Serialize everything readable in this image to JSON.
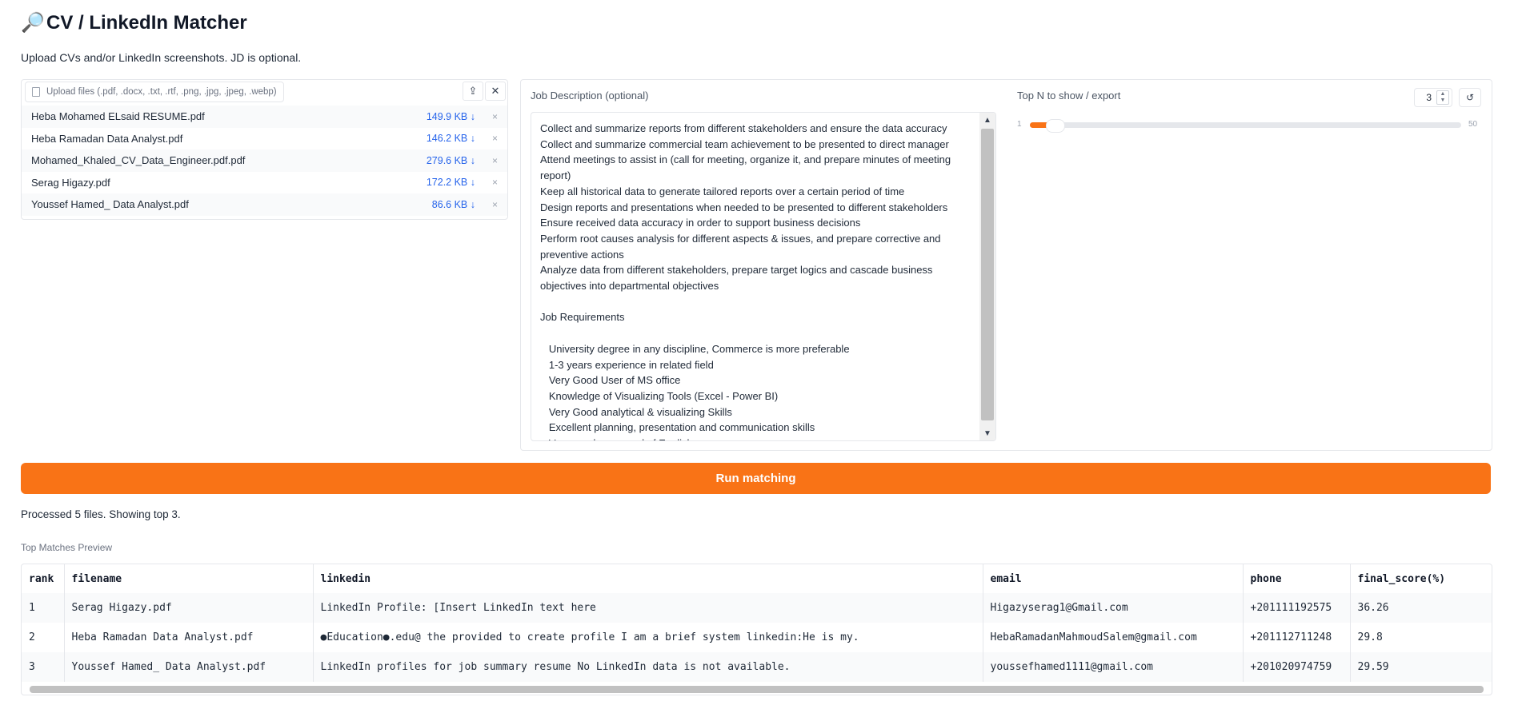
{
  "app": {
    "title_icon": "magnifier-icon",
    "title": "CV / LinkedIn Matcher",
    "subtitle": "Upload CVs and/or LinkedIn screenshots. JD is optional."
  },
  "upload": {
    "label": "Upload files (.pdf, .docx, .txt, .rtf, .png, .jpg, .jpeg, .webp)",
    "files": [
      {
        "name": "Heba Mohamed ELsaid RESUME.pdf",
        "size": "149.9 KB ↓"
      },
      {
        "name": "Heba Ramadan Data Analyst.pdf",
        "size": "146.2 KB ↓"
      },
      {
        "name": "Mohamed_Khaled_CV_Data_Engineer.pdf.pdf",
        "size": "279.6 KB ↓"
      },
      {
        "name": "Serag Higazy.pdf",
        "size": "172.2 KB ↓"
      },
      {
        "name": "Youssef Hamed_ Data Analyst.pdf",
        "size": "86.6 KB ↓"
      }
    ],
    "remove_glyph": "×"
  },
  "jd": {
    "label": "Job Description (optional)",
    "text": "Collect and summarize reports from different stakeholders and ensure the data accuracy\nCollect and summarize commercial team achievement to be presented to direct manager\nAttend meetings to assist in (call for meeting, organize it, and prepare minutes of meeting report)\nKeep all historical data to generate tailored reports over a certain period of time\nDesign reports and presentations when needed to be presented to different stakeholders\nEnsure received data accuracy in order to support business decisions\nPerform root causes analysis for different aspects & issues, and prepare corrective and preventive actions\nAnalyze data from different stakeholders, prepare target logics and cascade business objectives into departmental objectives\n\nJob Requirements\n\n   University degree in any discipline, Commerce is more preferable\n   1-3 years experience in related field\n   Very Good User of MS office\n   Knowledge of Visualizing Tools (Excel - Power BI)\n   Very Good analytical & visualizing Skills\n   Excellent planning, presentation and communication skills\n   Very good command of English"
  },
  "topn": {
    "label": "Top N to show / export",
    "value": "3",
    "min": "1",
    "max": "50",
    "fraction": 0.04
  },
  "run_button": "Run matching",
  "status": "Processed 5 files. Showing top 3.",
  "preview": {
    "label": "Top Matches Preview",
    "columns": [
      "rank",
      "filename",
      "linkedin",
      "email",
      "phone",
      "final_score(%)"
    ],
    "rows": [
      [
        "1",
        "Serag Higazy.pdf",
        "LinkedIn Profile: [Insert LinkedIn text here",
        "Higazyserag1@Gmail.com",
        "+201111192575",
        "36.26"
      ],
      [
        "2",
        "Heba Ramadan Data Analyst.pdf",
        "●Education●.edu@ the provided to create profile I am a brief system linkedin:He is my.",
        "HebaRamadanMahmoudSalem@gmail.com",
        "+201112711248",
        "29.8"
      ],
      [
        "3",
        "Youssef Hamed_ Data Analyst.pdf",
        "LinkedIn profiles for job summary resume No LinkedIn data is not available.",
        "youssefhamed1111@gmail.com",
        "+201020974759",
        "29.59"
      ]
    ]
  },
  "colors": {
    "accent": "#f97316",
    "link": "#2563eb"
  }
}
